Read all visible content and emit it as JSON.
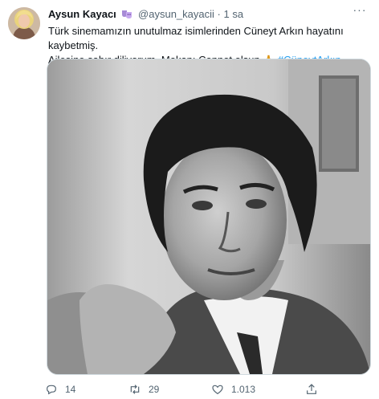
{
  "tweet": {
    "author_name": "Aysun Kayacı",
    "author_handle": "@aysun_kayacii",
    "separator": "·",
    "time": "1 sa",
    "text_line1": "Türk sinemamızın unutulmaz isimlerinden Cüneyt Arkın hayatını kaybetmiş.",
    "text_line2": "Ailesine sabır diliyorum. Mekanı Cennet olsun",
    "emoji": "🙏",
    "hashtag": "#CüneytArkın",
    "more_label": "···"
  },
  "actions": {
    "replies": "14",
    "retweets": "29",
    "likes": "1.013",
    "share": ""
  },
  "icons": {
    "badge": "theater-masks-icon",
    "reply": "reply-icon",
    "retweet": "retweet-icon",
    "like": "heart-icon",
    "share": "share-icon"
  },
  "colors": {
    "link": "#1d9bf0",
    "secondary_text": "#536471",
    "primary_text": "#0f1419"
  }
}
